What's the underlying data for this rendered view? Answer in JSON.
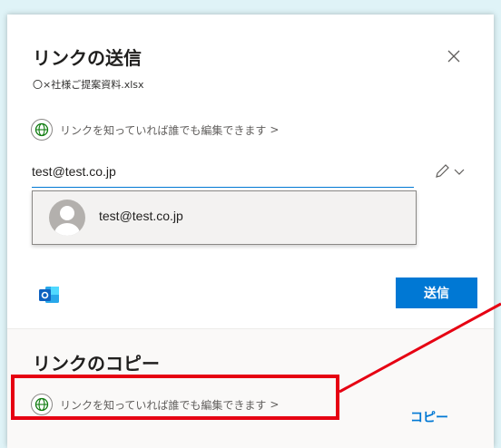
{
  "dialog": {
    "title": "リンクの送信",
    "file_name": "〇×社様ご提案資料.xlsx",
    "close_icon": "close-icon"
  },
  "send_section": {
    "link_setting": "リンクを知っていれば誰でも編集できます",
    "email_value": "test@test.co.jp",
    "suggestion_email": "test@test.co.jp",
    "send_label": "送信",
    "icons": [
      "globe-icon",
      "pencil-icon",
      "chevron-down-icon",
      "avatar",
      "outlook-icon"
    ]
  },
  "copy_section": {
    "title": "リンクのコピー",
    "link_setting": "リンクを知っていれば誰でも編集できます",
    "copy_label": "コピー"
  },
  "colors": {
    "accent": "#0078d4",
    "highlight": "#e60012",
    "globe": "#107c10"
  }
}
